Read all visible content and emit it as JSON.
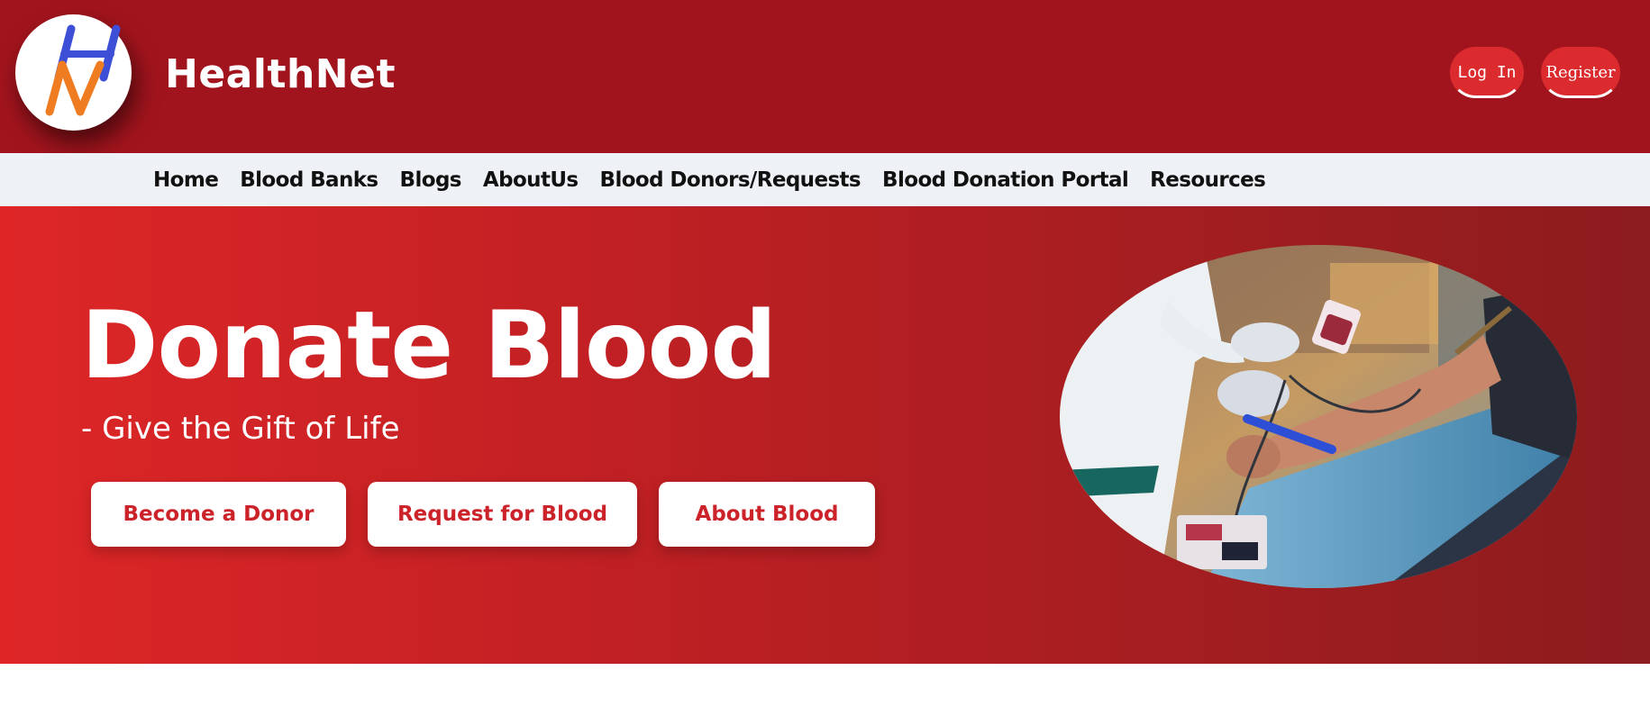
{
  "header": {
    "brand": "HealthNet",
    "logo_letters": "HN",
    "login_label": "Log In",
    "register_label": "Register",
    "colors": {
      "bar": "#a2141d",
      "button": "#dc2b2f",
      "logo_h": "#3d4fd6",
      "logo_n": "#f07c22"
    }
  },
  "nav": {
    "items": [
      "Home",
      "Blood Banks",
      "Blogs",
      "AboutUs",
      "Blood Donors/Requests",
      "Blood Donation Portal",
      "Resources"
    ]
  },
  "hero": {
    "title": "Donate Blood",
    "subtitle": "- Give the Gift of Life",
    "buttons": [
      "Become a Donor",
      "Request for Blood",
      "About Blood"
    ],
    "photo": "blood-donation-photo",
    "colors": {
      "gradient_start": "#de2627",
      "gradient_end": "#8c1c1e",
      "button_text": "#cc2229"
    }
  }
}
